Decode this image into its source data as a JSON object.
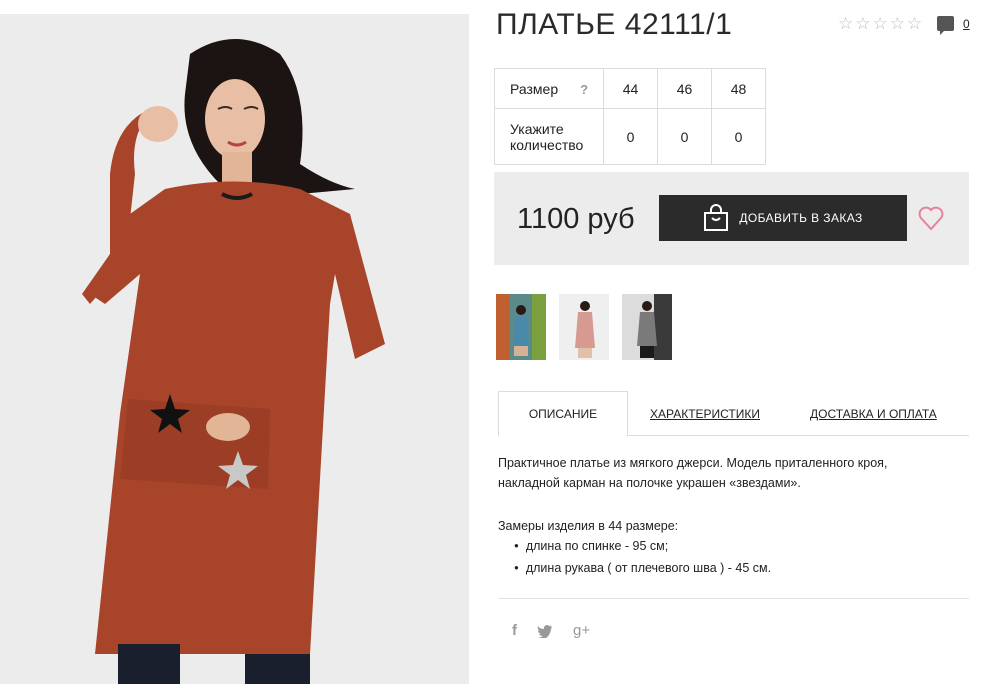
{
  "product": {
    "title": "ПЛАТЬЕ 42111/1",
    "rating_stars": [
      "☆",
      "☆",
      "☆",
      "☆",
      "☆"
    ],
    "comment_count": "0"
  },
  "sizes": {
    "size_label": "Размер",
    "help_label": "?",
    "quantity_label_line1": "Укажите",
    "quantity_label_line2": "количество",
    "columns": [
      "44",
      "46",
      "48"
    ],
    "quantities": [
      "0",
      "0",
      "0"
    ]
  },
  "purchase": {
    "price": "1100 руб",
    "order_button": "ДОБАВИТЬ В ЗАКАЗ",
    "accent_color": "#e8809a"
  },
  "tabs": {
    "description": "ОПИСАНИЕ",
    "specs": "ХАРАКТЕРИСТИКИ",
    "delivery": "ДОСТАВКА И ОПЛАТА"
  },
  "description": {
    "text_line1": "Практичное платье из мягкого джерси. Модель приталенного кроя,",
    "text_line2": "накладной карман на полочке украшен «звездами».",
    "measure_title": "Замеры изделия в 44 размере:",
    "measure_items": [
      "длина по спинке - 95 см;",
      "длина рукава ( от плечевого шва ) - 45 см."
    ]
  },
  "social": {
    "facebook": "f",
    "google": "g+"
  },
  "colors": {
    "dress": "#a8442a",
    "button_bg": "#2b2b2b",
    "panel_bg": "#ececec"
  }
}
